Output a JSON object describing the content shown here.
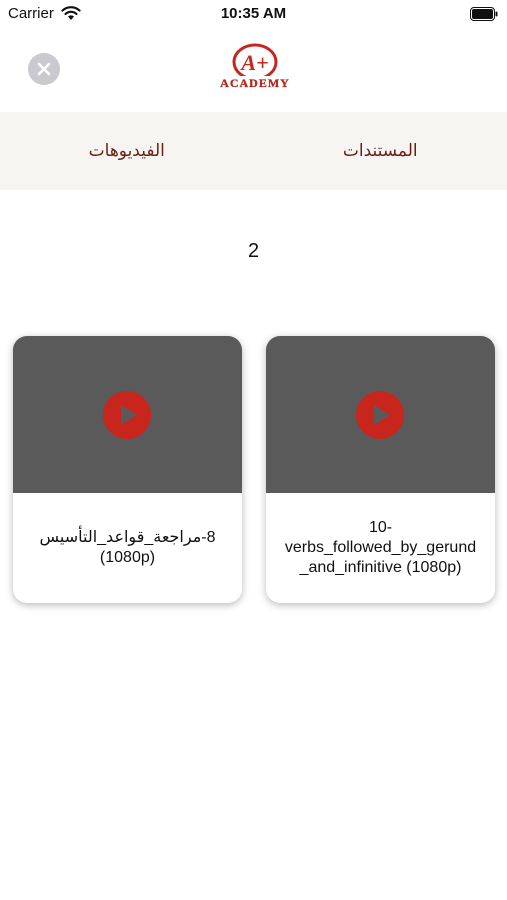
{
  "status_bar": {
    "carrier": "Carrier",
    "time": "10:35 AM"
  },
  "header": {
    "logo_letter": "A+",
    "logo_text": "ACADEMY",
    "brand_color": "#c8261d"
  },
  "tabs": [
    {
      "label": "الفيديوهات"
    },
    {
      "label": "المستندات"
    }
  ],
  "count": "2",
  "videos": [
    {
      "title_line1": "8-مراجعة_قواعد_التأسيس",
      "title_line2": "(1080p)"
    },
    {
      "title_line1": "10-",
      "title_line2": "verbs_followed_by_gerund",
      "title_line3": "_and_infinitive (1080p)"
    }
  ],
  "colors": {
    "tab_text": "#6b1f14",
    "thumb_bg": "#5a5a5a",
    "play_red": "#c8261d",
    "tabs_bg": "#f7f5f2"
  }
}
